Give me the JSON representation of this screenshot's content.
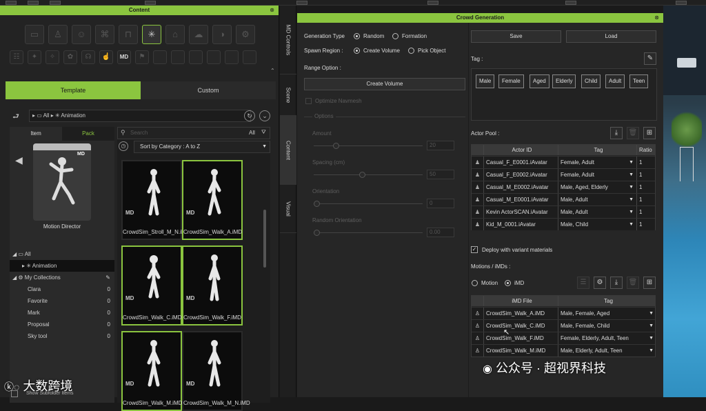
{
  "content_panel": {
    "title": "Content",
    "tabs": [
      "Template",
      "Custom"
    ],
    "breadcrumb": [
      "All",
      "Animation"
    ],
    "subtabs": [
      "Item",
      "Pack"
    ],
    "search_placeholder": "Search",
    "filter_label": "All",
    "sort_label": "Sort by Category : A to Z",
    "preview_label": "Motion Director",
    "tree": [
      {
        "label": "All",
        "count": ""
      },
      {
        "label": "Animation",
        "count": ""
      },
      {
        "label": "My Collections",
        "count": ""
      },
      {
        "label": "Clara",
        "count": "0"
      },
      {
        "label": "Favorite",
        "count": "0"
      },
      {
        "label": "Mark",
        "count": "0"
      },
      {
        "label": "Proposal",
        "count": "0"
      },
      {
        "label": "Sky tool",
        "count": "0"
      }
    ],
    "bottom_label": "Show Subfolder Items",
    "thumbnails": [
      {
        "label": "CrowdSim_Stroll_M_N.iMD",
        "selected": false
      },
      {
        "label": "CrowdSim_Walk_A.iMD",
        "selected": true
      },
      {
        "label": "CrowdSim_Walk_C.iMD",
        "selected": true
      },
      {
        "label": "CrowdSim_Walk_F.iMD",
        "selected": true
      },
      {
        "label": "CrowdSim_Walk_M.iMD",
        "selected": true
      },
      {
        "label": "CrowdSim_Walk_M_N.iMD",
        "selected": false
      }
    ]
  },
  "vertical_tabs": [
    "MD Controls",
    "Scene",
    "Content",
    "Visual"
  ],
  "crowd": {
    "title": "Crowd Generation",
    "generation_type_label": "Generation Type",
    "generation_options": [
      "Random",
      "Formation"
    ],
    "spawn_region_label": "Spawn Region :",
    "spawn_options": [
      "Create Volume",
      "Pick Object"
    ],
    "range_option_label": "Range Option :",
    "create_volume_button": "Create Volume",
    "optimize_navmesh": "Optimize Navmesh",
    "options_label": "Options",
    "amount_label": "Amount",
    "amount_value": "20",
    "spacing_label": "Spacing (cm)",
    "spacing_value": "50",
    "orientation_label": "Orientation",
    "orientation_value": "0",
    "random_orientation_label": "Random Orientation",
    "random_orientation_value": "0.00",
    "save_button": "Save",
    "load_button": "Load",
    "tag_label": "Tag :",
    "tags": [
      "Male",
      "Female",
      "Aged",
      "Elderly",
      "Child",
      "Adult",
      "Teen"
    ],
    "actor_pool_label": "Actor Pool :",
    "actor_headers": [
      "Actor ID",
      "Tag",
      "Ratio"
    ],
    "actors": [
      {
        "id": "Casual_F_E0001.iAvatar",
        "tag": "Female, Adult",
        "ratio": "1"
      },
      {
        "id": "Casual_F_E0002.iAvatar",
        "tag": "Female, Adult",
        "ratio": "1"
      },
      {
        "id": "Casual_M_E0002.iAvatar",
        "tag": "Male, Aged, Elderly",
        "ratio": "1"
      },
      {
        "id": "Casual_M_E0001.iAvatar",
        "tag": "Male, Adult",
        "ratio": "1"
      },
      {
        "id": "Kevin ActorSCAN.iAvatar",
        "tag": "Male, Adult",
        "ratio": "1"
      },
      {
        "id": "Kid_M_0001.iAvatar",
        "tag": "Male, Child",
        "ratio": "1"
      }
    ],
    "deploy_label": "Deploy with variant materials",
    "motions_label": "Motions / iMDs :",
    "motion_options": [
      "Motion",
      "iMD"
    ],
    "imd_headers": [
      "iMD File",
      "Tag"
    ],
    "imds": [
      {
        "file": "CrowdSim_Walk_A.iMD",
        "tag": "Male, Female, Aged"
      },
      {
        "file": "CrowdSim_Walk_C.iMD",
        "tag": "Male, Female, Child"
      },
      {
        "file": "CrowdSim_Walk_F.iMD",
        "tag": "Female, Elderly, Adult, Teen"
      },
      {
        "file": "CrowdSim_Walk_M.iMD",
        "tag": "Male, Elderly, Adult, Teen"
      }
    ]
  },
  "watermarks": {
    "left": "大数跨境",
    "right": "公众号 · 超视界科技"
  },
  "colors": {
    "accent": "#8bc53f"
  }
}
